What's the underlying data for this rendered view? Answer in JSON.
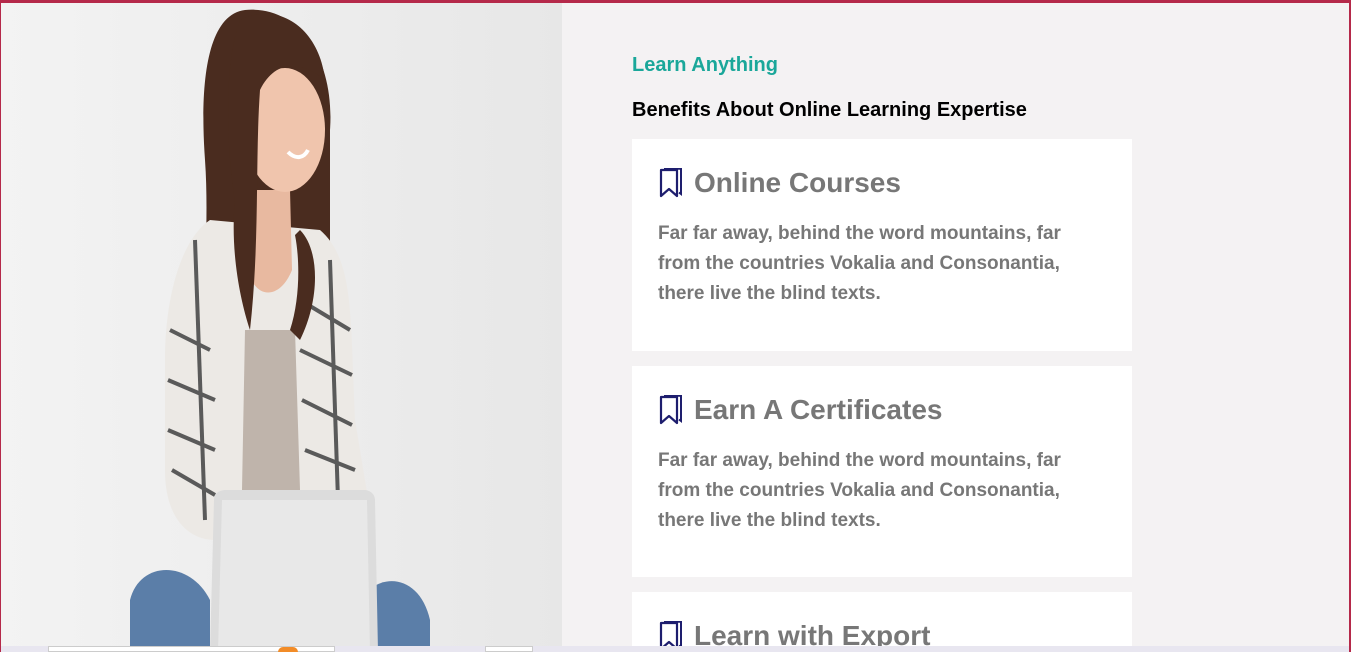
{
  "section": {
    "eyebrow": "Learn Anything",
    "heading": "Benefits About Online Learning Expertise"
  },
  "cards": [
    {
      "title": "Online Courses",
      "icon": "bookmark-icon",
      "text": "Far far away, behind the word mountains, far from the countries Vokalia and Consonantia, there live the blind texts."
    },
    {
      "title": "Earn A Certificates",
      "icon": "bookmark-icon",
      "text": "Far far away, behind the word mountains, far from the countries Vokalia and Consonantia, there live the blind texts."
    },
    {
      "title": "Learn with Export",
      "icon": "bookmark-icon",
      "text": ""
    }
  ],
  "colors": {
    "accent": "#1aa79a",
    "icon": "#1e1e6e",
    "card_text": "#777777",
    "page_bg": "#f4f2f3"
  }
}
